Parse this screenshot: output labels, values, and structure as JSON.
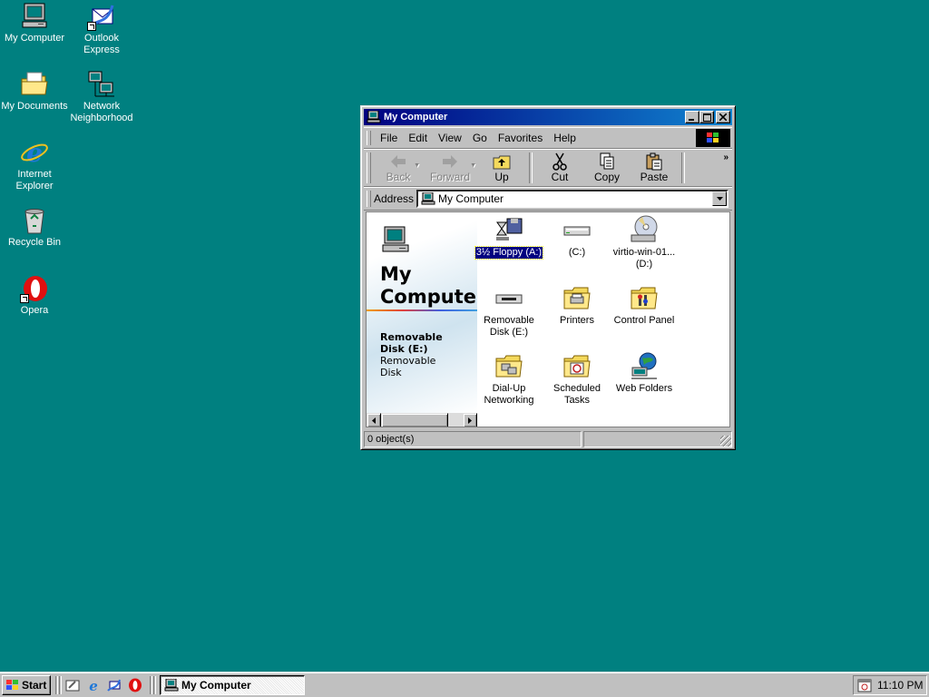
{
  "desktop": {
    "icons": [
      {
        "label": "My Computer",
        "icon": "my-computer-icon"
      },
      {
        "label": "Outlook Express",
        "icon": "outlook-express-icon"
      },
      {
        "label": "My Documents",
        "icon": "folder-icon"
      },
      {
        "label": "Network Neighborhood",
        "icon": "network-icon"
      },
      {
        "label": "Internet Explorer",
        "icon": "ie-icon"
      },
      {
        "label": "Recycle Bin",
        "icon": "recycle-bin-icon"
      },
      {
        "label": "Opera",
        "icon": "opera-icon"
      }
    ],
    "background_color": "#008080"
  },
  "window": {
    "title": "My Computer",
    "menu": [
      "File",
      "Edit",
      "View",
      "Go",
      "Favorites",
      "Help"
    ],
    "toolbar": {
      "back": "Back",
      "forward": "Forward",
      "up": "Up",
      "cut": "Cut",
      "copy": "Copy",
      "paste": "Paste"
    },
    "address": {
      "label": "Address",
      "value": "My Computer"
    },
    "side_panel": {
      "title_line1": "My",
      "title_line2": "Compute",
      "selected_name_1": "Removable",
      "selected_name_2": "Disk (E:)",
      "selected_desc_1": "Removable",
      "selected_desc_2": "Disk"
    },
    "items": [
      {
        "label": "3½ Floppy (A:)",
        "icon": "floppy-drive-icon",
        "selected": true
      },
      {
        "label": "(C:)",
        "icon": "hard-drive-icon"
      },
      {
        "label_1": "virtio-win-01...",
        "label_2": "(D:)",
        "icon": "cd-drive-icon"
      },
      {
        "label_1": "Removable",
        "label_2": "Disk (E:)",
        "icon": "removable-disk-icon"
      },
      {
        "label": "Printers",
        "icon": "printers-folder-icon"
      },
      {
        "label": "Control Panel",
        "icon": "control-panel-icon"
      },
      {
        "label_1": "Dial-Up",
        "label_2": "Networking",
        "icon": "dialup-networking-icon"
      },
      {
        "label_1": "Scheduled",
        "label_2": "Tasks",
        "icon": "scheduled-tasks-icon"
      },
      {
        "label": "Web Folders",
        "icon": "web-folders-icon"
      }
    ],
    "status": "0 object(s)"
  },
  "taskbar": {
    "start": "Start",
    "task_button": "My Computer",
    "clock": "11:10 PM"
  }
}
